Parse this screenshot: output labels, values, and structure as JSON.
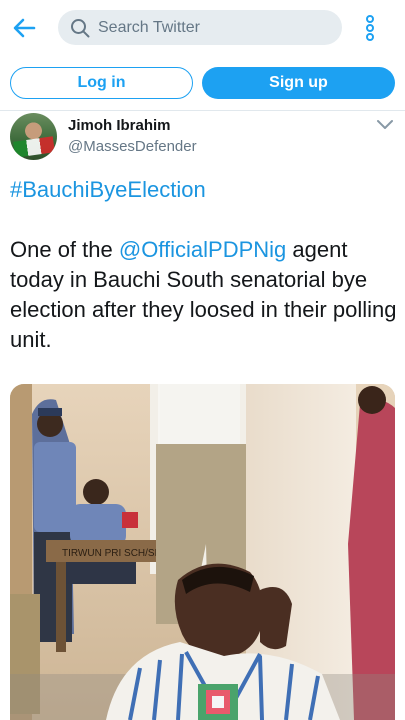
{
  "topbar": {
    "back_icon": "arrow-left-icon",
    "search_placeholder": "Search Twitter",
    "search_icon": "search-icon",
    "more_icon": "more-vertical-icon"
  },
  "auth": {
    "login_label": "Log in",
    "signup_label": "Sign up"
  },
  "tweet": {
    "author_name": "Jimoh Ibrahim",
    "author_handle": "@MassesDefender",
    "hashtag": "#BauchiByeElection",
    "text_before_mention": "One of the ",
    "mention": "@OfficialPDPNig",
    "text_after_mention": " agent today in Bauchi South senatorial bye election after they loosed in their polling unit.",
    "photo_sign_text": "TIRWUN PRI SCH/SEPIPA"
  },
  "colors": {
    "accent": "#1da1f2",
    "link": "#1b95e0",
    "muted": "#657786",
    "search_bg": "#e6ecf0"
  }
}
